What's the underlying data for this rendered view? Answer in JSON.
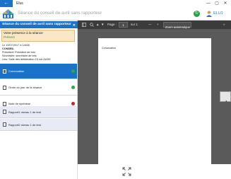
{
  "window": {
    "title": "Elus",
    "back_glyph": "←",
    "controls": [
      "—",
      "▢",
      "✕"
    ]
  },
  "header": {
    "title": "Séance du conseil de avril sans rapporteur",
    "user_name": "ELU1",
    "sync_glyph": "↻",
    "icons": [
      "logo-icon",
      "sync-icon",
      "user-icon"
    ]
  },
  "session": {
    "title": "Séance du conseil de avril sans rapporteur",
    "close_glyph": "✕",
    "presence_label": "Votre présence à la séance",
    "presence_status": "Présent",
    "info": [
      "Le 19/07/2017 à 14h30",
      "CONSEIL",
      "Président: Président de test",
      "Secrétaire: secrétaire de test",
      "Lieu: Salle des délibération 19 rue AUDE"
    ]
  },
  "agenda": [
    {
      "label": "Convocation",
      "active": true,
      "dot_color": "#2fa843"
    },
    {
      "label": "Ordre du jour de la séance",
      "active": false,
      "dot_color": "#2fa843"
    },
    {
      "label": "Note de synthèse",
      "active": false,
      "dot_color": "#c0282d"
    },
    {
      "label": "Rapport1 niveau 1 de test",
      "active": false,
      "sub": true
    },
    {
      "label": "Rapport2 niveau 1 de test",
      "active": false,
      "sub": true
    }
  ],
  "viewer": {
    "page_label": "Page :",
    "page_value": "1",
    "page_total": "sur 1",
    "zoom": "Zoom automatique",
    "minus": "—",
    "plus": "+",
    "more": "»",
    "document_text": "Convocation"
  },
  "colors": {
    "accent": "#1a73c9",
    "presence_bg": "#fbe6c6",
    "present": "#2f9c3c",
    "toolbar": "#3b3b3b"
  }
}
